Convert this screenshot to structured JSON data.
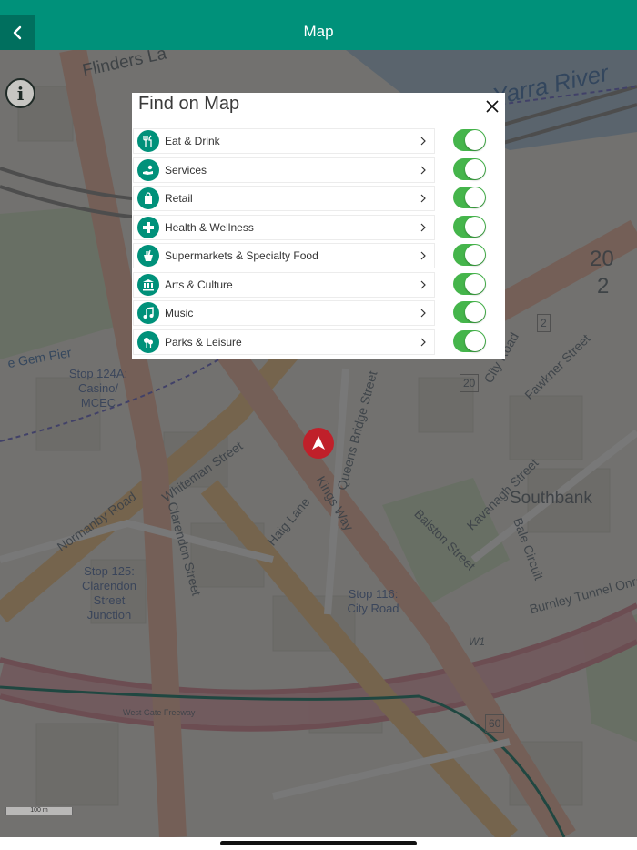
{
  "header": {
    "title": "Map",
    "back_icon": "chevron-left-icon"
  },
  "panel": {
    "title": "Find on Map",
    "close_icon": "close-icon",
    "categories": [
      {
        "label": "Eat & Drink",
        "icon": "utensils-icon",
        "enabled": true
      },
      {
        "label": "Services",
        "icon": "services-hand-icon",
        "enabled": true
      },
      {
        "label": "Retail",
        "icon": "shopping-bag-icon",
        "enabled": true
      },
      {
        "label": "Health & Wellness",
        "icon": "medical-cross-icon",
        "enabled": true
      },
      {
        "label": "Supermarkets & Specialty Food",
        "icon": "grocery-basket-icon",
        "enabled": true
      },
      {
        "label": "Arts & Culture",
        "icon": "museum-icon",
        "enabled": true
      },
      {
        "label": "Music",
        "icon": "music-note-icon",
        "enabled": true
      },
      {
        "label": "Parks & Leisure",
        "icon": "park-tree-icon",
        "enabled": true
      }
    ]
  },
  "map": {
    "labels": {
      "flinders": "Flinders La",
      "river": "Yarra River",
      "whiteman": "Whiteman Street",
      "clarendon": "Clarendon Street",
      "normanby": "Normanby Road",
      "kings_way": "Kings Way",
      "queensbridge": "Queens Bridge Street",
      "southbank": "Southbank",
      "haig": "Haig Lane",
      "balston": "Balston Street",
      "kavanagh": "Kavanagh Street",
      "bale": "Bale Circuit",
      "city_road": "City Road",
      "fawkner": "Fawkner Street",
      "burnley": "Burnley Tunnel Onra",
      "west_gate": "West Gate Freeway",
      "stop124": "Stop 124A: Casino/ MCEC",
      "stop125": "Stop 125: Clarendon Street Junction",
      "stop116": "Stop 116: City Road",
      "road_20": "20",
      "road_2": "2",
      "road_60": "60",
      "road_w1": "W1",
      "building_num": "20",
      "building_num2": "2",
      "gem_pier": "e Gem Pier",
      "scale": "100 m"
    },
    "info_icon": "info-icon",
    "location_icon": "navigation-arrow-icon"
  },
  "colors": {
    "accent": "#00917a",
    "accent_dark": "#006f5e",
    "toggle_on": "#45b54b",
    "marker": "#c0202a"
  }
}
